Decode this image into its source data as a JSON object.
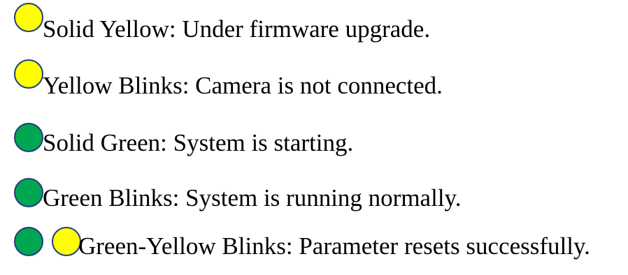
{
  "colors": {
    "yellow": "#ffff00",
    "green": "#00a651",
    "outline": "#1f3f7a"
  },
  "legend": [
    {
      "icons": [
        "yellow-led-icon"
      ],
      "text": "Solid Yellow: Under firmware upgrade."
    },
    {
      "icons": [
        "yellow-led-icon"
      ],
      "text": "Yellow Blinks: Camera is not connected."
    },
    {
      "icons": [
        "green-led-icon"
      ],
      "text": "Solid Green: System is starting."
    },
    {
      "icons": [
        "green-led-icon"
      ],
      "text": "Green Blinks: System is running normally."
    },
    {
      "icons": [
        "green-led-icon",
        "yellow-led-icon"
      ],
      "text": "Green-Yellow Blinks: Parameter resets successfully."
    }
  ]
}
